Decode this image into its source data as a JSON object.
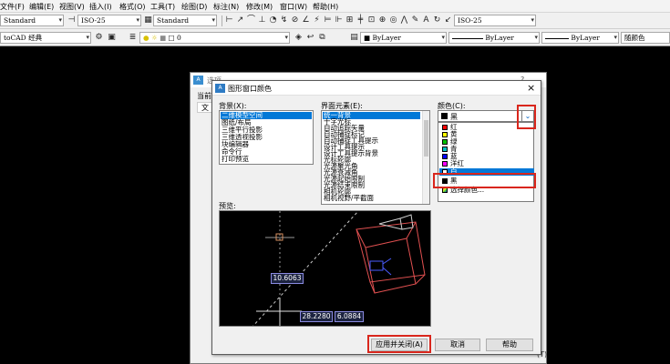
{
  "menubar": {
    "items": [
      "文件(F)",
      "编辑(E)",
      "视图(V)",
      "插入(I)",
      "格式(O)",
      "工具(T)",
      "绘图(D)",
      "标注(N)",
      "修改(M)",
      "窗口(W)",
      "帮助(H)"
    ]
  },
  "toolbar1": {
    "text_style": "Standard",
    "dim_style": "ISO-25",
    "table_style": "Standard",
    "mleader_style": "ISO-25"
  },
  "toolbar2": {
    "workspace": "toCAD 经典",
    "layer_value": "0",
    "color_control": "ByLayer",
    "linetype_control": "ByLayer",
    "lineweight_control": "ByLayer",
    "plotstyle_control": "随颜色"
  },
  "options_window": {
    "title": "选项",
    "help_glyph": "?",
    "current_label": "当前",
    "tab_fragment": "文"
  },
  "dialog": {
    "title": "图形窗口颜色",
    "close_glyph": "×",
    "context_label": "背景(X):",
    "context_items": [
      "二维模型空间",
      "图纸/布局",
      "三维平行投影",
      "三维透视投影",
      "块编辑器",
      "命令行",
      "打印预览"
    ],
    "interface_label": "界面元素(E):",
    "interface_items": [
      "统一背景",
      "十字光标",
      "自动追踪矢量",
      "自动捕捉标记",
      "自动捕捉工具提示",
      "设计工具提示",
      "设计工具提示背景",
      "光标轮廓",
      "光源聚光角",
      "光源衰减角",
      "光源起始限制",
      "光源结束限制",
      "相机轮廓",
      "相机视野/平截面"
    ],
    "color_label": "颜色(C):",
    "color_selected": "黑",
    "color_options": [
      {
        "name": "红",
        "hex": "#ff0000"
      },
      {
        "name": "黄",
        "hex": "#ffff00"
      },
      {
        "name": "绿",
        "hex": "#00c000"
      },
      {
        "name": "青",
        "hex": "#00c0c0"
      },
      {
        "name": "蓝",
        "hex": "#0000ff"
      },
      {
        "name": "洋红",
        "hex": "#ff00ff"
      },
      {
        "name": "白",
        "hex": "#ffffff"
      },
      {
        "name": "黑",
        "hex": "#000000"
      },
      {
        "name": "选择颜色...",
        "hex": "#5a8ad0"
      }
    ],
    "preview_label": "预览:",
    "preview_readouts": {
      "top_value": "10.6063",
      "x_value": "28.2280",
      "y_value": "6.0884"
    },
    "buttons": {
      "apply_close": "应用并关闭(A)",
      "cancel": "取消",
      "help": "帮助"
    },
    "back_button_fragment": "(T)"
  },
  "colors": {
    "highlight": "#0078d7",
    "annotation_red": "#d9261c",
    "drawing_bg": "#000000"
  }
}
